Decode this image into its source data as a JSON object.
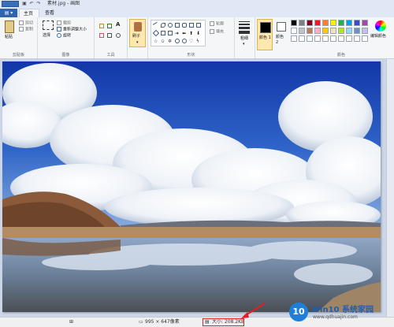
{
  "window": {
    "title": "素材.jpg - 画图"
  },
  "tabs": {
    "file": "▤ ▾",
    "home": "主页",
    "view": "查看"
  },
  "ribbon": {
    "clipboard": {
      "paste": "粘贴",
      "cut": "剪切",
      "copy": "复制",
      "group": "剪贴板"
    },
    "image": {
      "select": "选择",
      "crop": "裁剪",
      "resize": "重新调整大小",
      "rotate": "旋转",
      "group": "图像"
    },
    "tools": {
      "group": "工具",
      "text_tool": "A"
    },
    "brushes": {
      "label": "刷子"
    },
    "shapes": {
      "outline": "轮廓",
      "fill": "填充",
      "group": "形状"
    },
    "size": {
      "label": "粗细"
    },
    "color1": {
      "label": "颜色 1"
    },
    "color2": {
      "label": "颜色 2"
    },
    "colors": {
      "group": "颜色",
      "edit": "编辑颜色",
      "row1": [
        "#000000",
        "#7f7f7f",
        "#880015",
        "#ed1c24",
        "#ff7f27",
        "#fff200",
        "#22b14c",
        "#00a2e8",
        "#3f48cc",
        "#a349a4"
      ],
      "row2": [
        "#ffffff",
        "#c3c3c3",
        "#b97a57",
        "#ffaec9",
        "#ffc90e",
        "#efe4b0",
        "#b5e61d",
        "#99d9ea",
        "#7092be",
        "#c8bfe7"
      ],
      "row3": [
        "#ffffff",
        "#ffffff",
        "#ffffff",
        "#ffffff",
        "#ffffff",
        "#ffffff",
        "#ffffff",
        "#ffffff",
        "#ffffff",
        "#ffffff"
      ]
    }
  },
  "status": {
    "dimensions": "995 × 647像素",
    "filesize": "大小: 208.2KB"
  },
  "watermark": {
    "brand": "Win10 系统家园",
    "url": "www.qdhuajin.com",
    "logo": "10"
  }
}
